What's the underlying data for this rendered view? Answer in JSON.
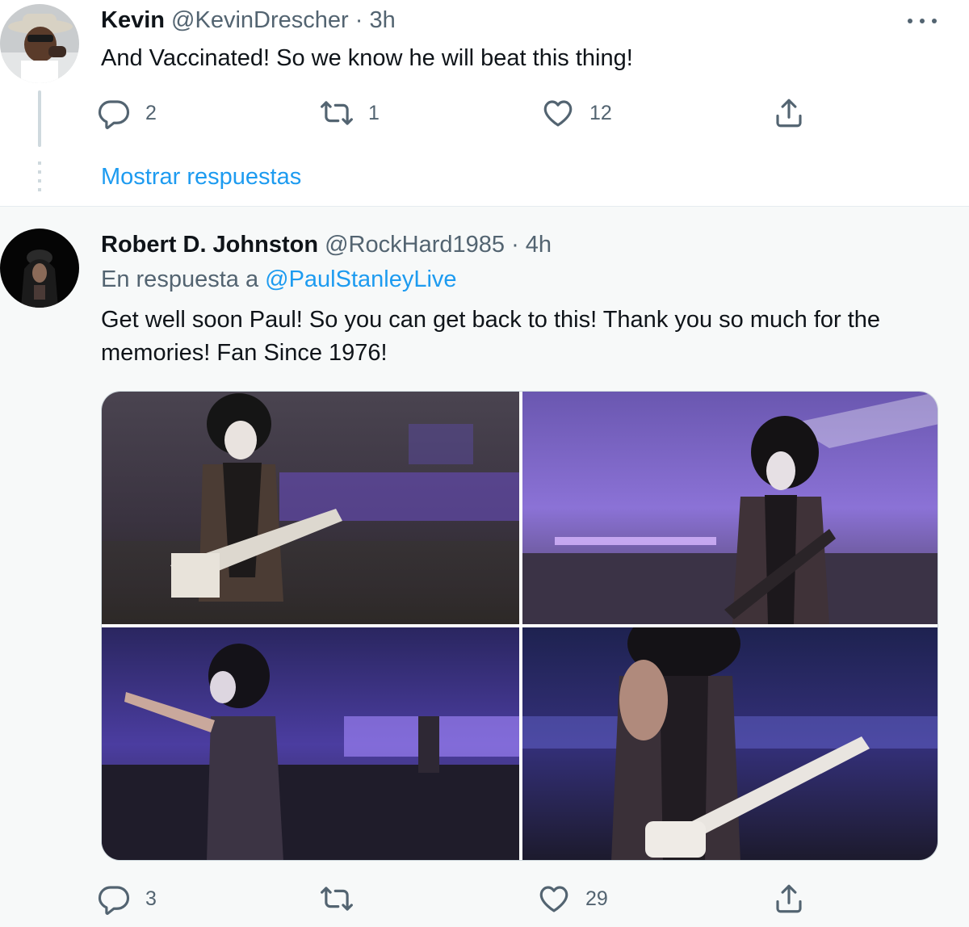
{
  "tweets": [
    {
      "name": "Kevin",
      "handle": "@KevinDrescher",
      "separator": "·",
      "time": "3h",
      "text": "And Vaccinated! So we know he will beat this thing!",
      "replies": "2",
      "retweets": "1",
      "likes": "12",
      "show_replies": "Mostrar respuestas"
    },
    {
      "name": "Robert D. Johnston",
      "handle": "@RockHard1985",
      "separator": "·",
      "time": "4h",
      "reply_prefix": "En respuesta a",
      "reply_mention": "@PaulStanleyLive",
      "text": "Get well soon Paul! So you can get back to this! Thank you so much for the memories! Fan Since 1976!",
      "replies": "3",
      "retweets": "",
      "likes": "29"
    }
  ],
  "icons": {
    "reply": "reply-icon",
    "retweet": "retweet-icon",
    "like": "heart-icon",
    "share": "share-icon",
    "more": "more-icon"
  },
  "colors": {
    "link": "#1d9bf0",
    "secondary_text": "#536471",
    "highlight_bg": "#f7f9f9"
  }
}
